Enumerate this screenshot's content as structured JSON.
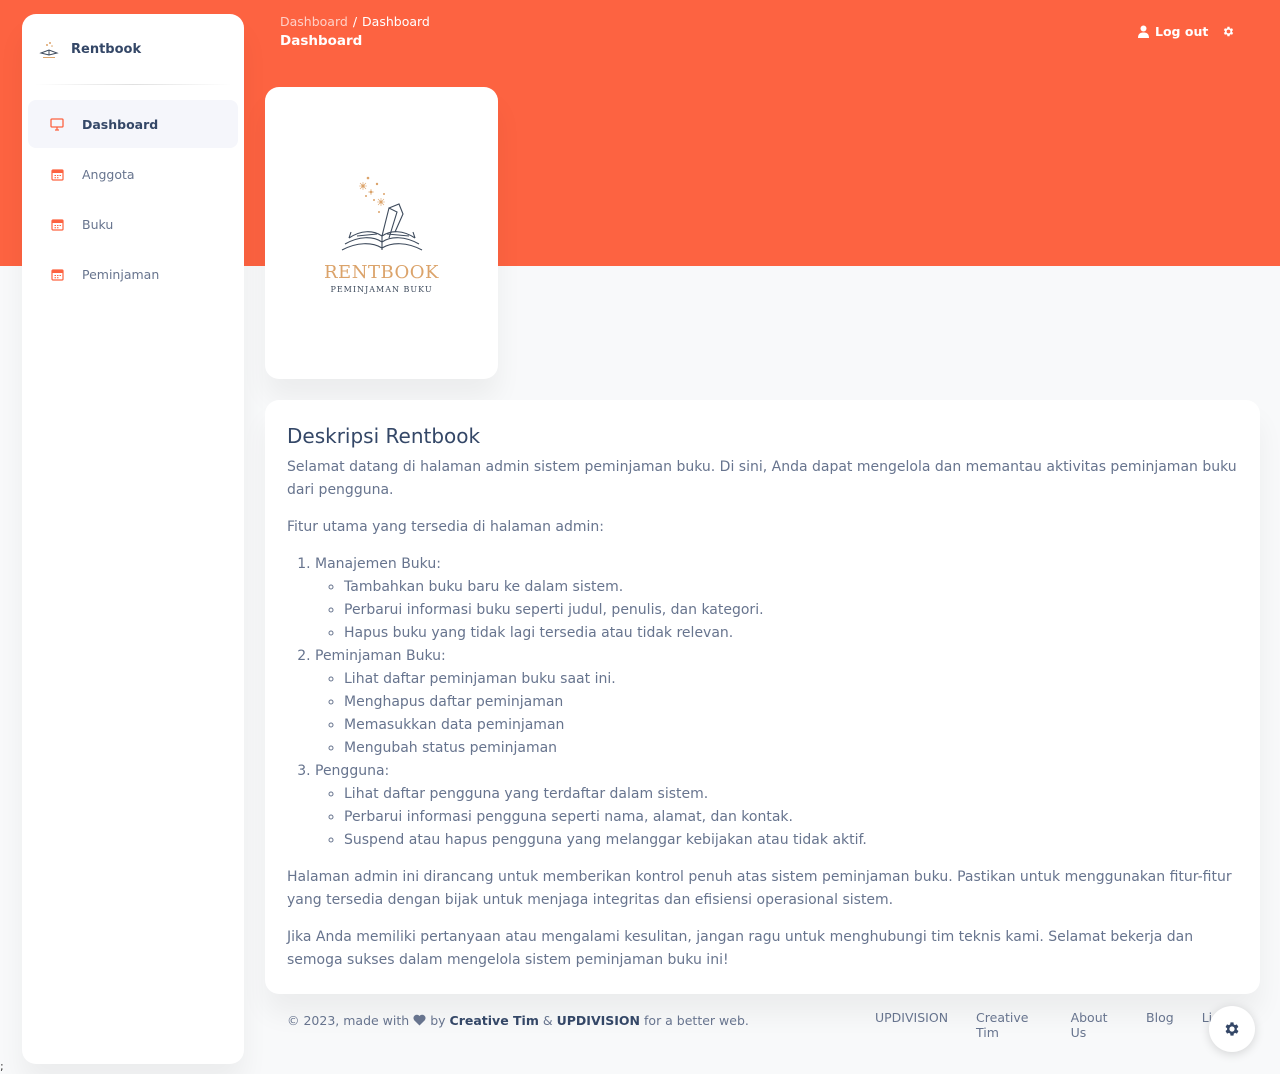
{
  "brand": {
    "name": "Rentbook"
  },
  "sidebar": {
    "items": [
      {
        "label": "Dashboard",
        "icon": "monitor-icon",
        "active": true
      },
      {
        "label": "Anggota",
        "icon": "calendar-icon"
      },
      {
        "label": "Buku",
        "icon": "calendar-icon"
      },
      {
        "label": "Peminjaman",
        "icon": "calendar-icon"
      }
    ]
  },
  "header": {
    "breadcrumb": [
      "Dashboard",
      "Dashboard"
    ],
    "breadcrumb_sep": "/",
    "title": "Dashboard",
    "logout_label": "Log out"
  },
  "logo_card": {
    "title": "RENTBOOK",
    "subtitle": "PEMINJAMAN BUKU"
  },
  "description": {
    "title": "Deskripsi Rentbook",
    "intro": "Selamat datang di halaman admin sistem peminjaman buku. Di sini, Anda dapat mengelola dan memantau aktivitas peminjaman buku dari pengguna.",
    "features_intro": "Fitur utama yang tersedia di halaman admin:",
    "features": [
      {
        "title": "Manajemen Buku:",
        "items": [
          "Tambahkan buku baru ke dalam sistem.",
          "Perbarui informasi buku seperti judul, penulis, dan kategori.",
          "Hapus buku yang tidak lagi tersedia atau tidak relevan."
        ]
      },
      {
        "title": "Peminjaman Buku:",
        "items": [
          "Lihat daftar peminjaman buku saat ini.",
          "Menghapus daftar peminjaman",
          "Memasukkan data peminjaman",
          "Mengubah status peminjaman"
        ]
      },
      {
        "title": "Pengguna:",
        "items": [
          "Lihat daftar pengguna yang terdaftar dalam sistem.",
          "Perbarui informasi pengguna seperti nama, alamat, dan kontak.",
          "Suspend atau hapus pengguna yang melanggar kebijakan atau tidak aktif."
        ]
      }
    ],
    "closing": "Halaman admin ini dirancang untuk memberikan kontrol penuh atas sistem peminjaman buku. Pastikan untuk menggunakan fitur-fitur yang tersedia dengan bijak untuk menjaga integritas dan efisiensi operasional sistem.",
    "contact": "Jika Anda memiliki pertanyaan atau mengalami kesulitan, jangan ragu untuk menghubungi tim teknis kami. Selamat bekerja dan semoga sukses dalam mengelola sistem peminjaman buku ini!"
  },
  "footer": {
    "copy_prefix": "© 2023, made with",
    "by": "by",
    "author1": "Creative Tim",
    "amp": "&",
    "author2": "UPDIVISION",
    "copy_suffix": "for a better web.",
    "links": [
      "UPDIVISION",
      "Creative Tim",
      "About Us",
      "Blog",
      "Lic"
    ]
  },
  "stray_text": ";",
  "colors": {
    "accent": "#fd6341",
    "heading": "#344767",
    "text": "#67748e"
  }
}
